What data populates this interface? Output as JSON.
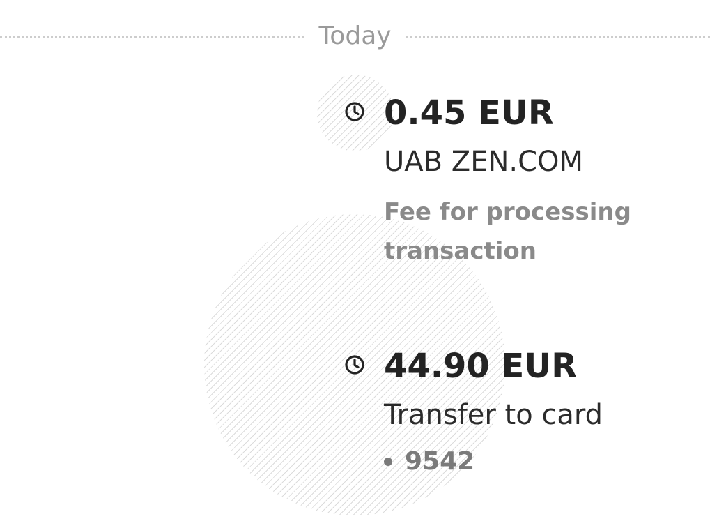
{
  "header": {
    "date_label": "Today"
  },
  "transactions": [
    {
      "status_icon": "clock-icon",
      "amount": "0.45 EUR",
      "merchant": "UAB ZEN.COM",
      "description": "Fee for processing transaction"
    },
    {
      "status_icon": "clock-icon",
      "amount": "44.90 EUR",
      "merchant": "Transfer to card",
      "card_last4": "9542"
    }
  ],
  "colors": {
    "text_primary": "#232323",
    "text_secondary": "#8a8a8a",
    "separator": "#cdcdcd"
  }
}
